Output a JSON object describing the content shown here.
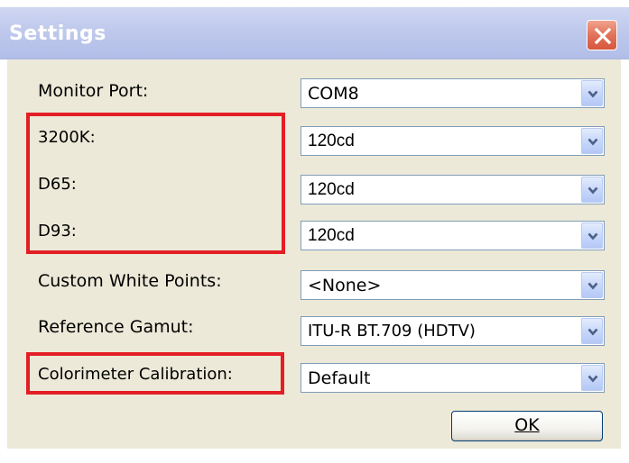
{
  "window": {
    "title": "Settings"
  },
  "fields": [
    {
      "label": "Monitor Port:",
      "value": "COM8"
    },
    {
      "label": "3200K:",
      "value": "120cd"
    },
    {
      "label": "D65:",
      "value": "120cd"
    },
    {
      "label": "D93:",
      "value": "120cd"
    },
    {
      "label": "Custom White Points:",
      "value": "<None>"
    },
    {
      "label": "Reference Gamut:",
      "value": "ITU-R BT.709 (HDTV)"
    },
    {
      "label": "Colorimeter Calibration:",
      "value": "Default"
    }
  ],
  "buttons": {
    "ok_label": "OK"
  },
  "icons": {
    "close": "close-icon",
    "dropdown": "chevron-down-icon"
  },
  "colors": {
    "highlight": "#e31e25",
    "title_bar": "#bfc9ec",
    "dialog_bg": "#ece9d8"
  }
}
